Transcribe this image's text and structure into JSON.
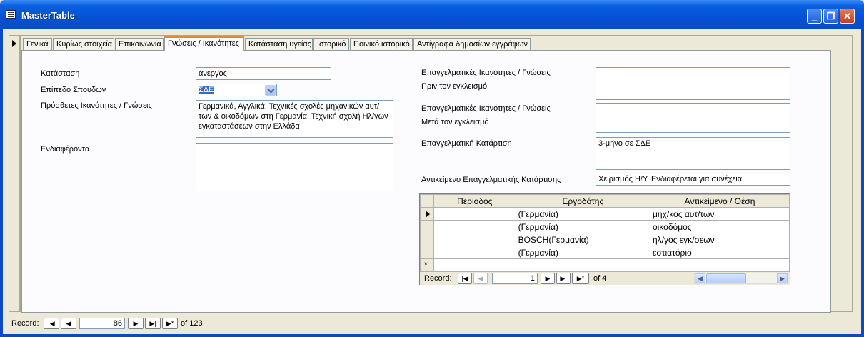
{
  "window": {
    "title": "MasterTable",
    "minimize": "_",
    "restore": "❐",
    "close": "✕"
  },
  "tabs": [
    {
      "label": "Γενικά"
    },
    {
      "label": "Κυρίως στοιχεία"
    },
    {
      "label": "Επικοινωνία"
    },
    {
      "label": "Γνώσεις / Ικανότητες"
    },
    {
      "label": "Κατάσταση υγείας"
    },
    {
      "label": "Ιστορικό"
    },
    {
      "label": "Ποινικό ιστορικό"
    },
    {
      "label": "Αντίγραφα δημοσίων εγγράφων"
    }
  ],
  "active_tab": "Γνώσεις / Ικανότητες",
  "form": {
    "katastasi_label": "Κατάσταση",
    "katastasi_value": "άνεργος",
    "epipedo_label": "Επίπεδο Σπουδών",
    "epipedo_value": "ΣΔΕ",
    "prosthetes_label": "Πρόσθετες Ικανότητες / Γνώσεις",
    "prosthetes_value": "Γερμανικά, Αγγλικά. Τεχνικές σχολές μηχανικών αυτ/των & οικοδόμων στη Γερμανία. Τεχνική σχολή Ηλ/γων εγκαταστάσεων στην Ελλάδα",
    "endiaferonta_label": "Ενδιαφέροντα",
    "endiaferonta_value": "",
    "pro_label_1": "Επαγγελματικές Ικανότητες / Γνώσεις",
    "pro_label_2": "Πριν τον εγκλεισμό",
    "pro_value": "",
    "meta_label_1": "Επαγγελματικές Ικανότητες / Γνώσεις",
    "meta_label_2": "Μετά τον εγκλεισμό",
    "meta_value": "",
    "katartisi_label": "Επαγγελματική Κατάρτιση",
    "katartisi_value": "3-μηνο σε ΣΔΕ",
    "antikeimeno_label": "Αντικείμενο Επαγγελματικής Κατάρτισης",
    "antikeimeno_value": "Χειρισμός Η/Υ. Ενδιαφέρεται για συνέχεια"
  },
  "subform": {
    "columns": [
      "Περίοδος",
      "Εργοδότης",
      "Αντικείμενο / Θέση"
    ],
    "rows": [
      {
        "period": "",
        "employer": "(Γερμανία)",
        "position": "μηχ/κος αυτ/των"
      },
      {
        "period": "",
        "employer": "(Γερμανία)",
        "position": "οικοδόμος"
      },
      {
        "period": "",
        "employer": " BOSCH(Γερμανία)",
        "position": "ηλ/γος εγκ/σεων"
      },
      {
        "period": "",
        "employer": "(Γερμανία)",
        "position": "εστιατόριο"
      }
    ],
    "new_row_marker": "*",
    "nav": {
      "label": "Record:",
      "current": "1",
      "of_text": "of  4"
    }
  },
  "main_nav": {
    "label": "Record:",
    "current": "86",
    "of_text": "of  123"
  }
}
